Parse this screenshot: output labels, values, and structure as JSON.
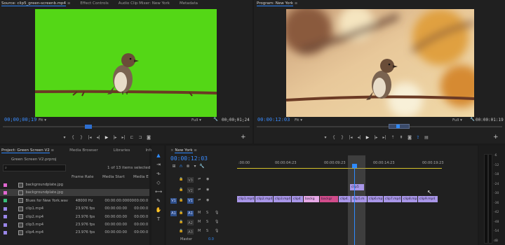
{
  "source_panel": {
    "tabs": [
      "Source: clip5_green-screenb.mp4",
      "Effect Controls",
      "Audio Clip Mixer: New York",
      "Metadata"
    ],
    "timecode_left": "00;00;00;19",
    "fit": "Fit",
    "quality": "Full",
    "timecode_right": "00;00;01;24"
  },
  "program_panel": {
    "title": "Program: New York",
    "timecode_left": "00:00:12:03",
    "fit": "Fit",
    "quality": "Full",
    "timecode_right": "00:00:01:19"
  },
  "project_panel": {
    "tabs": [
      "Project: Green Screen V2",
      "Media Browser",
      "Libraries",
      "Info",
      "Ef"
    ],
    "project_file": "Green Screen V2.prproj",
    "items_selected": "1 of 13 items selected",
    "columns": [
      "Frame Rate",
      "Media Start",
      "Media E"
    ],
    "rows": [
      {
        "name": "backgroundplate.jpg",
        "frame_rate": "",
        "media_start": "",
        "media_end": "",
        "color": "#e067d0",
        "selected": false
      },
      {
        "name": "backgroundplate.jpg",
        "frame_rate": "",
        "media_start": "",
        "media_end": "",
        "color": "#e067d0",
        "selected": true
      },
      {
        "name": "Blues for New York.wav",
        "frame_rate": "48000 Hz",
        "media_start": "00:00:00:00000",
        "media_end": "00:00:0",
        "color": "#37c07a",
        "selected": false
      },
      {
        "name": "clip1.mp4",
        "frame_rate": "23.976 fps",
        "media_start": "00:00:00:00",
        "media_end": "00:00:0",
        "color": "#9a86e8",
        "selected": false
      },
      {
        "name": "clip2.mp4",
        "frame_rate": "23.976 fps",
        "media_start": "00:00:00:00",
        "media_end": "00:00:0",
        "color": "#9a86e8",
        "selected": false
      },
      {
        "name": "clip3.mp4",
        "frame_rate": "23.976 fps",
        "media_start": "00:00:00:00",
        "media_end": "00:00:0",
        "color": "#9a86e8",
        "selected": false
      },
      {
        "name": "clip4.mp4",
        "frame_rate": "23.976 fps",
        "media_start": "00:00:00:00",
        "media_end": "00:00:0",
        "color": "#9a86e8",
        "selected": false
      }
    ]
  },
  "timeline": {
    "sequence_name": "New York",
    "timecode": "00:00:12:03",
    "ruler_ticks": [
      ":00:00",
      "00:00:04:23",
      "00:00:09:23",
      "00:00:14:23",
      "00:00:19:23"
    ],
    "video_tracks": [
      "V3",
      "V2",
      "V1"
    ],
    "audio_tracks": [
      "A1",
      "A2",
      "A3"
    ],
    "source_patch_video": "V1",
    "source_patch_audio": "A1",
    "master_label": "Master",
    "master_value": "0.0",
    "v2_clip": "clip5",
    "v1_clips": [
      "clip1.mp4",
      "clip2.mp4",
      "clip3.mp4",
      "clip4",
      "backg",
      "backgr",
      "clip4.",
      "clip5.m",
      "clip6.mp",
      "clip7.mp4",
      "clip8.mp",
      "clip9.mp4"
    ]
  },
  "audio_meter": {
    "db_labels": [
      "-6",
      "-12",
      "-18",
      "-24",
      "-30",
      "-36",
      "-42",
      "-48",
      "-54",
      "dB"
    ]
  },
  "colors": {
    "accent": "#2e8bff",
    "green_screen": "#54d716",
    "clip_video": "#a896e8",
    "clip_background": "#e6a8e6"
  }
}
